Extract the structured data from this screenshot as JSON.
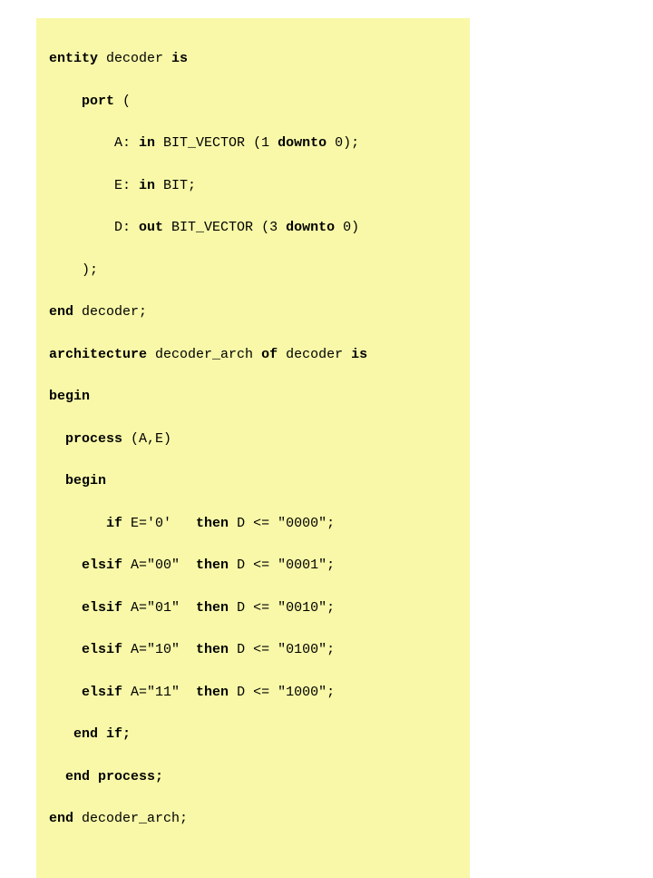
{
  "code": {
    "l1_entity": "entity",
    "l1_name": " decoder ",
    "l1_is": "is",
    "l2_port": "    port ",
    "l2_paren": "(",
    "l3_pre": "        A: ",
    "l3_in": "in",
    "l3_mid": " BIT_VECTOR (1 ",
    "l3_downto": "downto",
    "l3_post": " 0);",
    "l4_pre": "        E: ",
    "l4_in": "in",
    "l4_post": " BIT;",
    "l5_pre": "        D: ",
    "l5_out": "out",
    "l5_mid": " BIT_VECTOR (3 ",
    "l5_downto": "downto",
    "l5_post": " 0)",
    "l6": "    );",
    "l7_end": "end",
    "l7_post": " decoder;",
    "l8_arch": "architecture",
    "l8_mid": " decoder_arch ",
    "l8_of": "of",
    "l8_mid2": " decoder ",
    "l8_is": "is",
    "l9": "begin",
    "l10_pre": "  ",
    "l10_process": "process",
    "l10_post": " (A,E)",
    "l11_pre": "  ",
    "l11_begin": "begin",
    "l12_pre": "       ",
    "l12_if": "if",
    "l12_cond": " E='0'   ",
    "l12_then": "then",
    "l12_post": " D <= \"0000\";",
    "l13_pre": "    ",
    "l13_elsif": "elsif",
    "l13_cond": " A=\"00\"  ",
    "l13_then": "then",
    "l13_post": " D <= \"0001\";",
    "l14_pre": "    ",
    "l14_elsif": "elsif",
    "l14_cond": " A=\"01\"  ",
    "l14_then": "then",
    "l14_post": " D <= \"0010\";",
    "l15_pre": "    ",
    "l15_elsif": "elsif",
    "l15_cond": " A=\"10\"  ",
    "l15_then": "then",
    "l15_post": " D <= \"0100\";",
    "l16_pre": "    ",
    "l16_elsif": "elsif",
    "l16_cond": " A=\"11\"  ",
    "l16_then": "then",
    "l16_post": " D <= \"1000\";",
    "l17_pre": "   ",
    "l17_end": "end",
    "l17_if": " if;",
    "l18_pre": "  ",
    "l18_end": "end",
    "l18_process": " process;",
    "l19_end": "end",
    "l19_post": " decoder_arch;"
  }
}
